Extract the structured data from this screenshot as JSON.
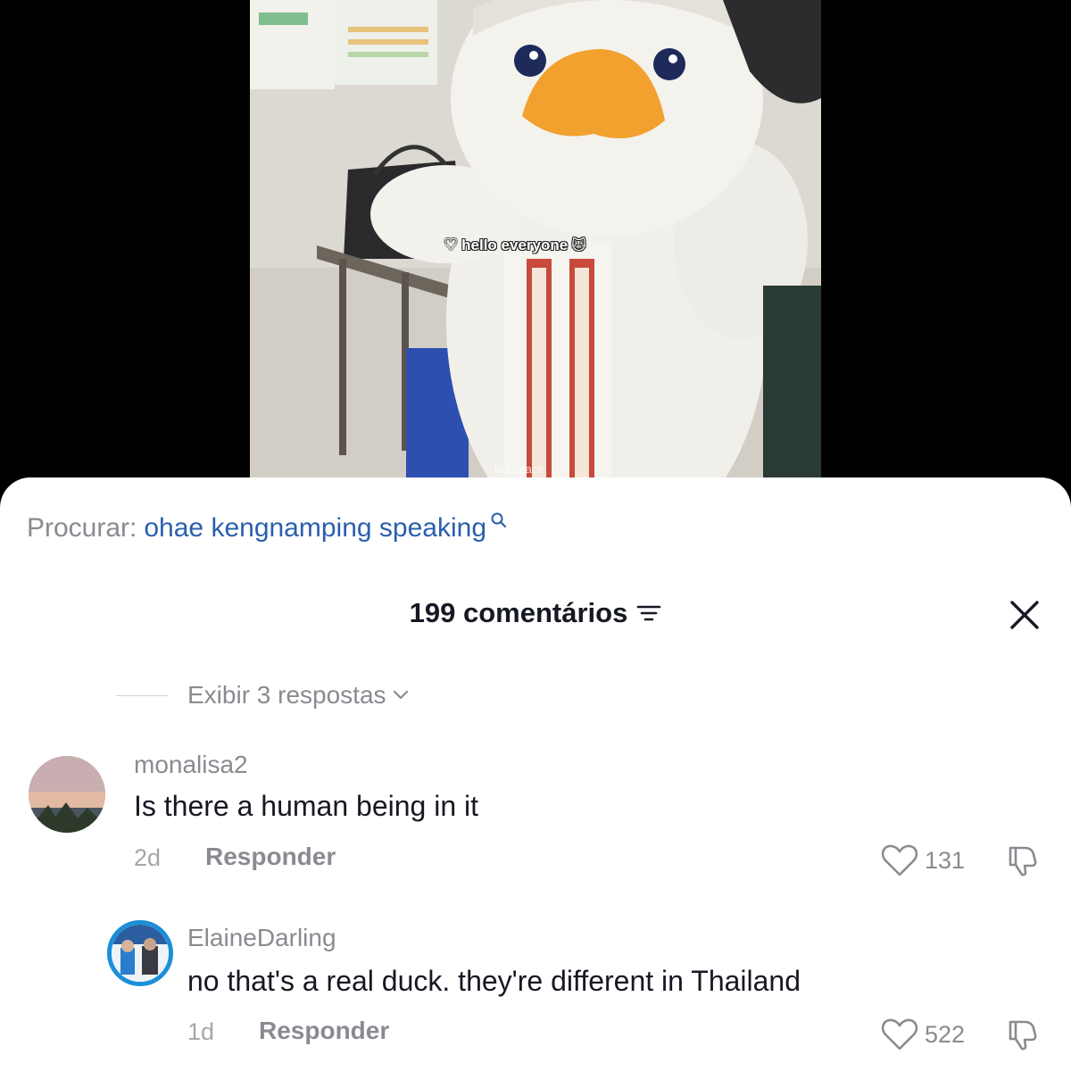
{
  "video": {
    "caption": "hello everyone",
    "caption_heart": "♡",
    "caption_emoji": "🐱",
    "watermark": "tus space"
  },
  "search": {
    "label": "Procurar:",
    "query": "ohae kengnamping speaking"
  },
  "header": {
    "title": "199 comentários"
  },
  "view_replies": {
    "label": "Exibir 3 respostas"
  },
  "comments": [
    {
      "username": "monalisa2",
      "text": "Is there a human being in it",
      "time": "2d",
      "reply_label": "Responder",
      "likes": "131"
    },
    {
      "username": "ElaineDarling",
      "text": "no that's a real duck. they're different in Thailand",
      "time": "1d",
      "reply_label": "Responder",
      "likes": "522"
    }
  ],
  "colors": {
    "link_blue": "#2a5fae",
    "muted_gray": "#8a8b91",
    "text_dark": "#161823",
    "avatar_ring": "#1b8fd8"
  },
  "icons": [
    "search-icon",
    "filter-icon",
    "close-icon",
    "chevron-down-icon",
    "heart-icon",
    "dislike-icon"
  ]
}
